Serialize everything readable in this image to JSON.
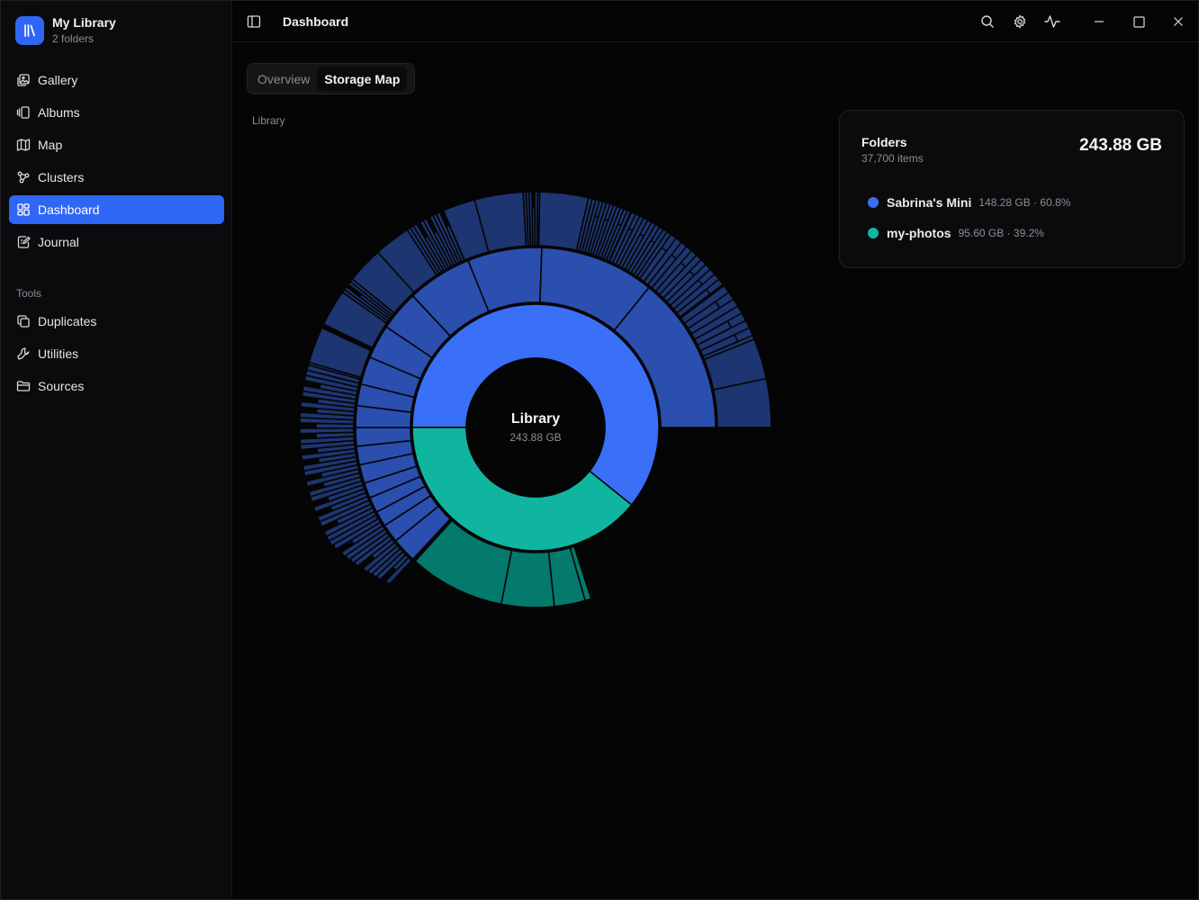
{
  "library": {
    "name": "My Library",
    "subtitle": "2 folders"
  },
  "nav": [
    {
      "label": "Gallery",
      "icon": "gallery-icon",
      "active": false
    },
    {
      "label": "Albums",
      "icon": "albums-icon",
      "active": false
    },
    {
      "label": "Map",
      "icon": "map-icon",
      "active": false
    },
    {
      "label": "Clusters",
      "icon": "clusters-icon",
      "active": false
    },
    {
      "label": "Dashboard",
      "icon": "dashboard-icon",
      "active": true
    },
    {
      "label": "Journal",
      "icon": "journal-icon",
      "active": false
    }
  ],
  "tools_label": "Tools",
  "tools": [
    {
      "label": "Duplicates",
      "icon": "duplicates-icon"
    },
    {
      "label": "Utilities",
      "icon": "wrench-icon"
    },
    {
      "label": "Sources",
      "icon": "folder-icon"
    }
  ],
  "topbar": {
    "title": "Dashboard"
  },
  "tabs": [
    {
      "label": "Overview",
      "active": false
    },
    {
      "label": "Storage Map",
      "active": true
    }
  ],
  "breadcrumb": "Library",
  "chart_center": {
    "title": "Library",
    "size": "243.88 GB"
  },
  "card": {
    "title": "Folders",
    "count": "37,700 items",
    "total": "243.88 GB",
    "items": [
      {
        "name": "Sabrina's Mini",
        "meta": "148.28 GB · 60.8%",
        "color": "#3a6ff7"
      },
      {
        "name": "my-photos",
        "meta": "95.60 GB · 39.2%",
        "color": "#10b5a0"
      }
    ]
  },
  "colors": {
    "accent": "#2f66f5",
    "blue": "#3a6ff7",
    "teal": "#10b5a0"
  },
  "chart_data": {
    "type": "sunburst",
    "root": {
      "name": "Library",
      "value_gb": 243.88
    },
    "children": [
      {
        "name": "Sabrina's Mini",
        "value_gb": 148.28,
        "percent": 60.8
      },
      {
        "name": "my-photos",
        "value_gb": 95.6,
        "percent": 39.2
      }
    ]
  }
}
